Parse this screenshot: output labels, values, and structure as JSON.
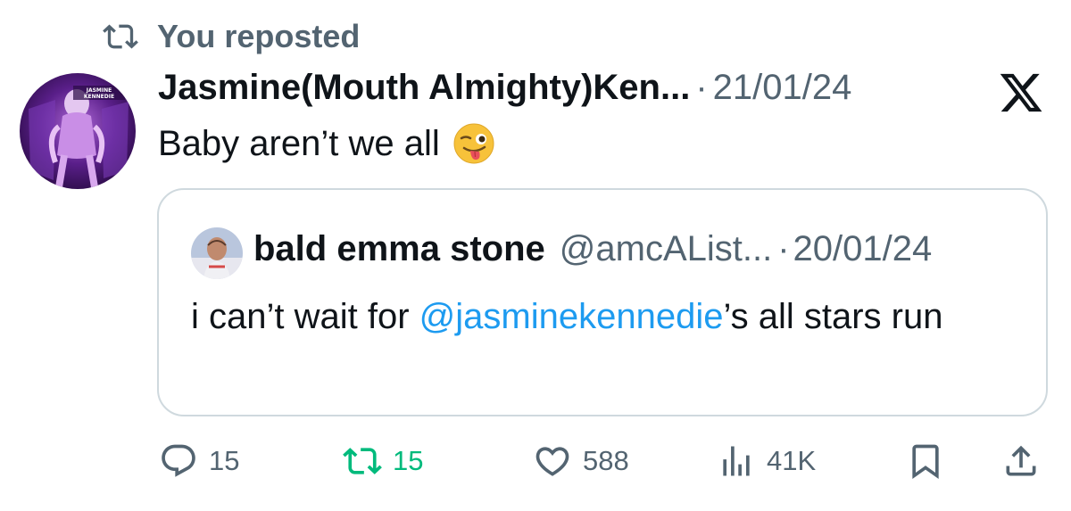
{
  "repost_banner": {
    "label": "You reposted",
    "icon": "repost-icon"
  },
  "tweet": {
    "author_name": "Jasmine(Mouth Almighty)Ken...",
    "separator": "·",
    "date": "21/01/24",
    "text": "Baby aren’t we all",
    "emoji": "winking-face-with-tongue",
    "avatar_banner_text": "JASMINE KENNEDIE",
    "platform_logo": "x-logo"
  },
  "quoted_tweet": {
    "author_name": "bald emma stone",
    "handle": "@amcAList...",
    "separator": "·",
    "date": "20/01/24",
    "text_before": "i can’t wait for ",
    "mention": "@jasminekennedie",
    "text_after": "’s all stars run"
  },
  "actions": {
    "replies": "15",
    "reposts": "15",
    "likes": "588",
    "views": "41K"
  },
  "colors": {
    "text": "#0f1419",
    "secondary": "#536471",
    "accent": "#1d9bf0",
    "repost_active": "#00ba7c",
    "border": "#cfd9de"
  }
}
